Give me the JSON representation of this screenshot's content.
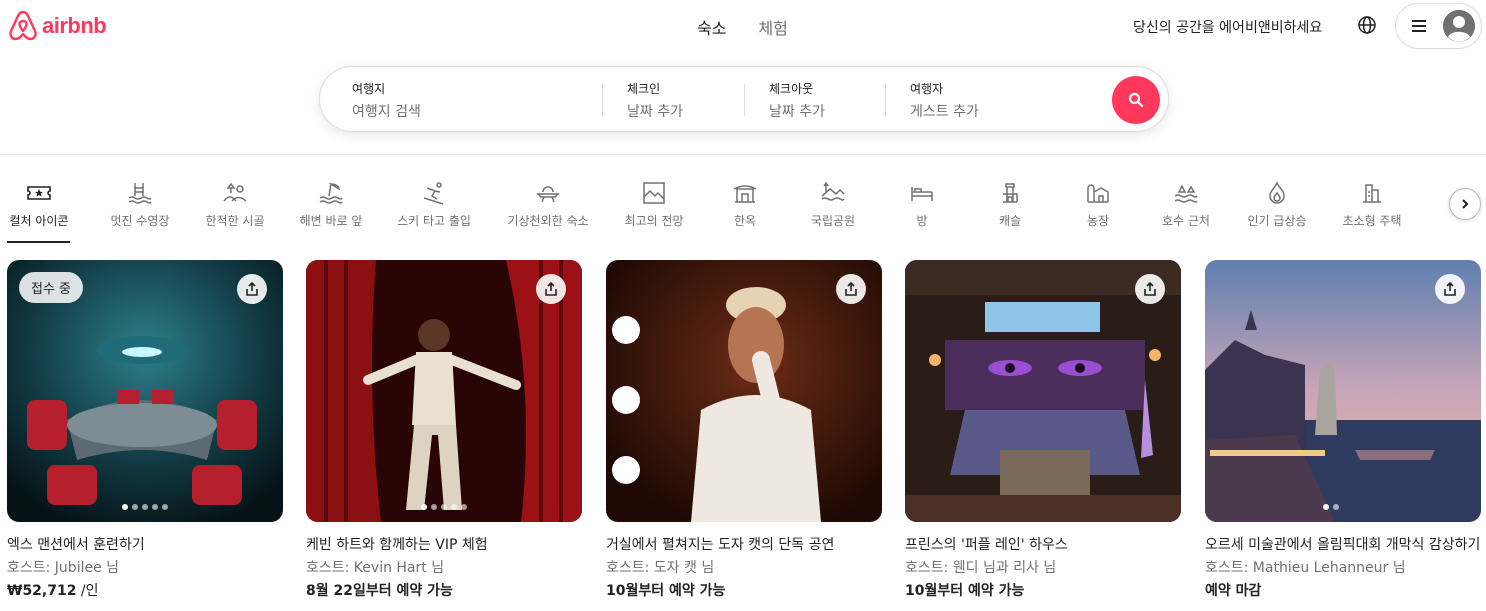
{
  "header": {
    "brand": "airbnb",
    "tabs": [
      {
        "label": "숙소",
        "active": true
      },
      {
        "label": "체험",
        "active": false
      }
    ],
    "host_link": "당신의 공간을 에어비앤비하세요",
    "globe_icon": "globe-icon",
    "menu_icon": "hamburger-icon",
    "avatar_icon": "user-avatar-icon"
  },
  "search": {
    "where_label": "여행지",
    "where_value": "여행지 검색",
    "checkin_label": "체크인",
    "checkin_value": "날짜 추가",
    "checkout_label": "체크아웃",
    "checkout_value": "날짜 추가",
    "guests_label": "여행자",
    "guests_value": "게스트 추가",
    "button_icon": "search-icon",
    "accent": "#ff385c"
  },
  "categories": [
    {
      "label": "컬처 아이콘",
      "icon": "ticket-star-icon",
      "active": true
    },
    {
      "label": "멋진 수영장",
      "icon": "pool-icon"
    },
    {
      "label": "한적한 시골",
      "icon": "countryside-icon"
    },
    {
      "label": "해변 바로 앞",
      "icon": "beach-icon"
    },
    {
      "label": "스키 타고 출입",
      "icon": "ski-icon"
    },
    {
      "label": "기상천외한 숙소",
      "icon": "ufo-icon"
    },
    {
      "label": "최고의 전망",
      "icon": "view-frame-icon"
    },
    {
      "label": "한옥",
      "icon": "hanok-icon"
    },
    {
      "label": "국립공원",
      "icon": "national-park-icon"
    },
    {
      "label": "방",
      "icon": "bed-icon"
    },
    {
      "label": "캐슬",
      "icon": "castle-icon"
    },
    {
      "label": "농장",
      "icon": "farm-icon"
    },
    {
      "label": "호수 근처",
      "icon": "lake-icon"
    },
    {
      "label": "인기 급상승",
      "icon": "flame-icon"
    },
    {
      "label": "초소형 주택",
      "icon": "tiny-house-icon"
    }
  ],
  "listings": [
    {
      "title": "엑스 맨션에서 훈련하기",
      "host": "호스트: Jubilee 님",
      "price": "₩52,712",
      "price_unit": " /인",
      "badge": "접수 중"
    },
    {
      "title": "케빈 하트와 함께하는 VIP 체험",
      "host": "호스트: Kevin Hart 님",
      "price": "8월 22일부터 예약 가능"
    },
    {
      "title": "거실에서 펼쳐지는 도자 캣의 단독 공연",
      "host": "호스트: 도자 캣 님",
      "price": "10월부터 예약 가능"
    },
    {
      "title": "프린스의 '퍼플 레인' 하우스",
      "host": "호스트: 웬디 님과 리사 님",
      "price": "10월부터 예약 가능"
    },
    {
      "title": "오르세 미술관에서 올림픽대회 개막식 감상하기",
      "host": "호스트: Mathieu Lehanneur 님",
      "price": "예약 마감"
    }
  ]
}
